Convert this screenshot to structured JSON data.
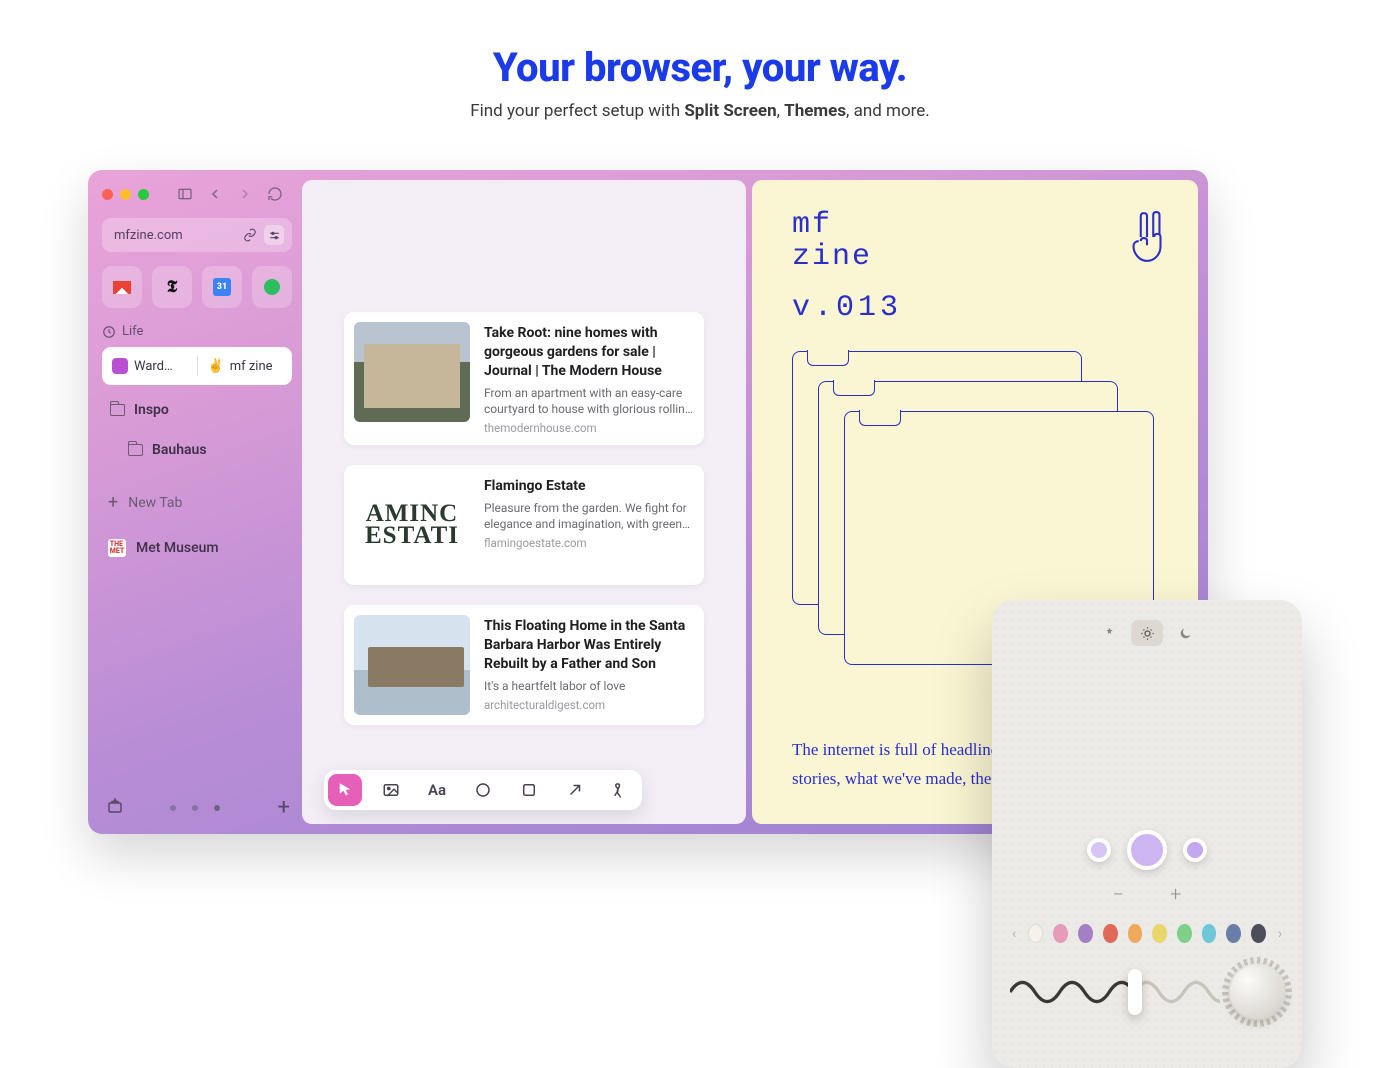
{
  "hero": {
    "title": "Your browser, your way.",
    "sub_pre": "Find your perfect setup with ",
    "sub_b1": "Split Screen",
    "sub_mid": ", ",
    "sub_b2": "Themes",
    "sub_post": ", and more."
  },
  "sidebar": {
    "url": "mfzine.com",
    "favorites": [
      {
        "name": "gmail"
      },
      {
        "name": "nyt"
      },
      {
        "name": "calendar",
        "badge": "31"
      },
      {
        "name": "evernote"
      }
    ],
    "section": "Life",
    "split": {
      "left": "Ward…",
      "right": "mf zine"
    },
    "folders": [
      {
        "label": "Inspo"
      },
      {
        "label": "Bauhaus"
      }
    ],
    "newtab": "New Tab",
    "tabs": [
      {
        "icon": "met",
        "label": "Met Museum"
      }
    ]
  },
  "cards": [
    {
      "title": "Take Root: nine homes with gorgeous gardens for sale | Journal | The Modern House",
      "desc": "From an apartment with an easy-care courtyard to house with glorious rolling groun…",
      "url": "themodernhouse.com"
    },
    {
      "title": "Flamingo Estate",
      "desc": "Pleasure from the garden. We fight for elegance and imagination, with green thumbs…",
      "url": "flamingoestate.com"
    },
    {
      "title": "This Floating Home in the Santa Barbara Harbor Was Entirely Rebuilt by a Father and Son",
      "desc": "It's a heartfelt labor of love",
      "url": "architecturaldigest.com"
    }
  ],
  "editor_tools": [
    "pointer",
    "image",
    "text",
    "circle",
    "square",
    "arrow",
    "draw"
  ],
  "zine": {
    "t1": "mf",
    "t2": "zine",
    "ver": "v.013",
    "prose": "The internet is full of headlines, but where are our stories, what we've made, the paths we've taken"
  },
  "theme": {
    "modes": [
      "auto",
      "light",
      "dark"
    ],
    "swatches": {
      "main_color": "#cdb5f2"
    },
    "minus": "−",
    "plus": "+",
    "palette": [
      "#f6f2ea",
      "#e89ab9",
      "#a47fc4",
      "#e06a5a",
      "#f0a95a",
      "#ead76b",
      "#7ecf88",
      "#6fc6d6",
      "#6a7fa8",
      "#4a4e5a"
    ]
  }
}
